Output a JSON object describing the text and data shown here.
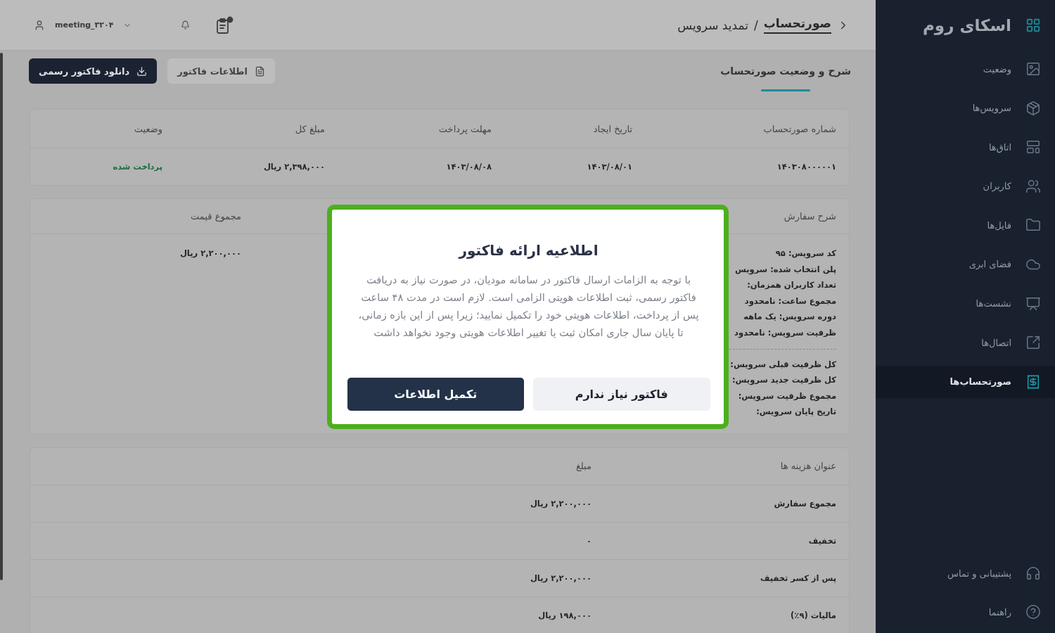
{
  "sidebar": {
    "logo": "اسکای روم",
    "items": [
      {
        "label": "وضعیت",
        "selected": false
      },
      {
        "label": "سرویس‌ها",
        "selected": false
      },
      {
        "label": "اتاق‌ها",
        "selected": false
      },
      {
        "label": "کاربران",
        "selected": false
      },
      {
        "label": "فایل‌ها",
        "selected": false
      },
      {
        "label": "فضای ابری",
        "selected": false
      },
      {
        "label": "نشست‌ها",
        "selected": false
      },
      {
        "label": "اتصال‌ها",
        "selected": false
      },
      {
        "label": "صورتحساب‌ها",
        "selected": true
      }
    ],
    "footer_items": [
      {
        "label": "پشتیبانی و تماس"
      },
      {
        "label": "راهنما"
      }
    ]
  },
  "header": {
    "breadcrumb": {
      "parent": "صورتحساب",
      "separator": "/",
      "current": "تمدید سرویس"
    },
    "user": "meeting_۳۲۰۴"
  },
  "toolbar": {
    "tabs": [
      {
        "label": "شرح و وضعیت صورتحساب",
        "selected": true
      }
    ],
    "buttons": [
      {
        "label": "اطلاعات فاکتور",
        "kind": "secondary"
      },
      {
        "label": "دانلود فاکتور رسمی",
        "kind": "primary"
      }
    ]
  },
  "invoice_table": {
    "columns": [
      "شماره صورتحساب",
      "تاریخ ایجاد",
      "مهلت پرداخت",
      "مبلغ کل",
      "وضعیت"
    ],
    "rows": [
      {
        "cells": [
          "۱۴۰۳۰۸۰۰۰۰۰۱",
          "۱۴۰۳/۰۸/۰۱",
          "۱۴۰۳/۰۸/۰۸",
          "۲,۳۹۸,۰۰۰ ریال"
        ],
        "status": "پرداخت شده",
        "paid": true
      }
    ]
  },
  "order_table": {
    "columns": [
      "شرح سفارش",
      "مجموع قیمت"
    ],
    "detail_groups": [
      [
        "کد سرویس: ۹۵",
        "پلن انتخاب شده: سرویس",
        "تعداد کاربران همزمان:",
        "مجموع ساعت: نامحدود",
        "دوره سرویس: یک ماهه",
        "ظرفیت سرویس: نامحدود"
      ],
      [
        "کل ظرفیت قبلی سرویس:",
        "کل ظرفیت جدید سرویس:",
        "مجموع ظرفیت سرویس:",
        "تاریخ پایان سرویس:"
      ]
    ],
    "total": "۲,۲۰۰,۰۰۰ ریال"
  },
  "cost_table": {
    "columns": [
      "عنوان هزینه ها",
      "مبلغ"
    ],
    "rows": [
      [
        "مجموع سفارش",
        "۲,۲۰۰,۰۰۰ ریال"
      ],
      [
        "تخفیف",
        "۰"
      ],
      [
        "پس از کسر تخفیف",
        "۲,۲۰۰,۰۰۰ ریال"
      ],
      [
        "مالیات (۹٪)",
        "۱۹۸,۰۰۰ ریال"
      ]
    ]
  },
  "dialog": {
    "title": "اطلاعیه ارائه فاکتور",
    "message": "با توجه به الزامات ارسال فاکتور در سامانه مودیان، در صورت نیاز به دریافت\nفاکتور رسمی، ثبت اطلاعات هویتی الزامی است. لازم است در مدت ۴۸ ساعت\nپس از پرداخت، اطلاعات هویتی خود را تکمیل نمایید؛ زیرا پس از این بازه زمانی،\nتا پایان سال جاری امکان ثبت یا تغییر اطلاعات هویتی وجود نخواهد داشت",
    "buttons": [
      {
        "label": "فاکتور نیاز ندارم",
        "kind": "secondary"
      },
      {
        "label": "تکمیل اطلاعات",
        "kind": "primary"
      }
    ]
  }
}
